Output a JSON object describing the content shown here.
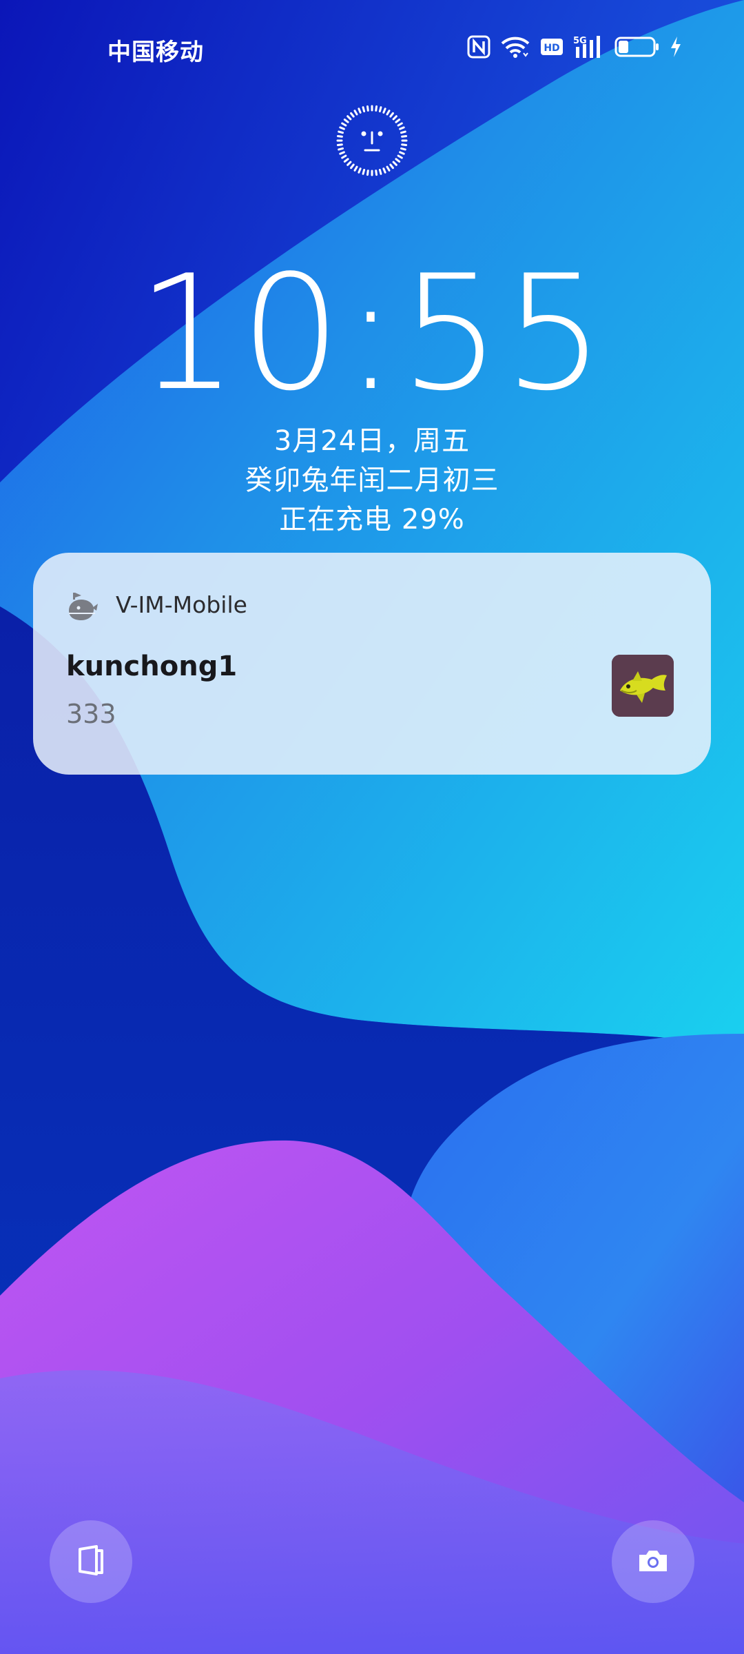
{
  "status_bar": {
    "carrier": "中国移动",
    "network_label": "5G",
    "hd_label": "HD",
    "battery_level": 0.29,
    "icons": [
      "nfc-icon",
      "wifi-icon",
      "hd-icon",
      "signal-5g-icon",
      "battery-icon",
      "charging-bolt-icon"
    ]
  },
  "lock_indicator": {
    "icon": "face-unlock-icon"
  },
  "clock": {
    "time": "10:55",
    "date": "3月24日，周五",
    "lunar_date": "癸卯兔年闰二月初三",
    "charging_status": "正在充电 29%"
  },
  "notification": {
    "app_icon": "v-im-app-icon",
    "app_name": "V-IM-Mobile",
    "title": "kunchong1",
    "body": "333",
    "thumbnail": "sender-avatar"
  },
  "shortcuts": {
    "left_icon": "wallet-icon",
    "right_icon": "camera-icon"
  },
  "colors": {
    "background_deep": "#0a1fa8",
    "background_cyan": "#1fc2ee",
    "wave_purple": "#a953ee",
    "wave_violet": "#6c5cf2",
    "notification_bg": "#e9f1fb"
  }
}
